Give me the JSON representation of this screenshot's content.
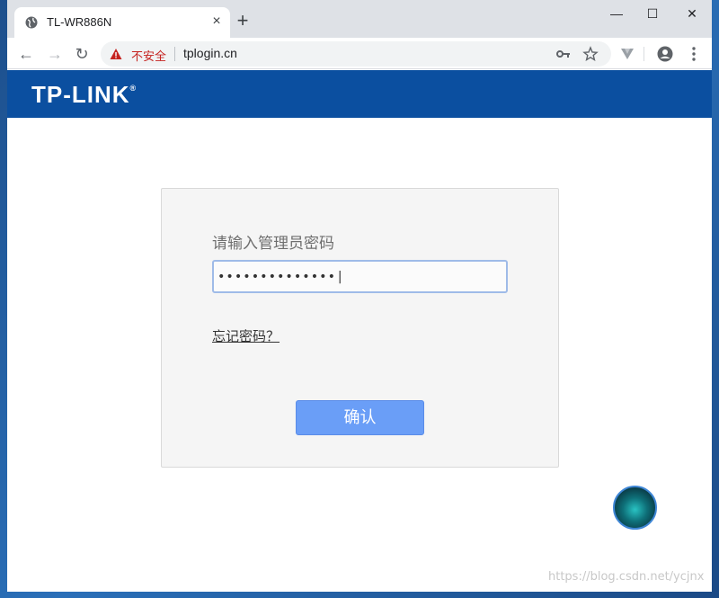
{
  "browser": {
    "tab_title": "TL-WR886N",
    "tab_close": "×",
    "new_tab": "+",
    "window_controls": {
      "minimize": "—",
      "maximize": "☐",
      "close": "✕"
    },
    "nav": {
      "back": "←",
      "forward": "→",
      "reload": "↻"
    },
    "address": {
      "security_label": "不安全",
      "url": "tplogin.cn"
    }
  },
  "header": {
    "logo_text": "TP-LINK",
    "logo_mark": "®",
    "bg_color": "#0b4fa0"
  },
  "login": {
    "prompt": "请输入管理员密码",
    "password_value": "••••••••••••••|",
    "forgot_link": "忘记密码？",
    "confirm_label": "确认",
    "button_color": "#6a9ef7"
  },
  "watermark": "https://blog.csdn.net/ycjnx"
}
